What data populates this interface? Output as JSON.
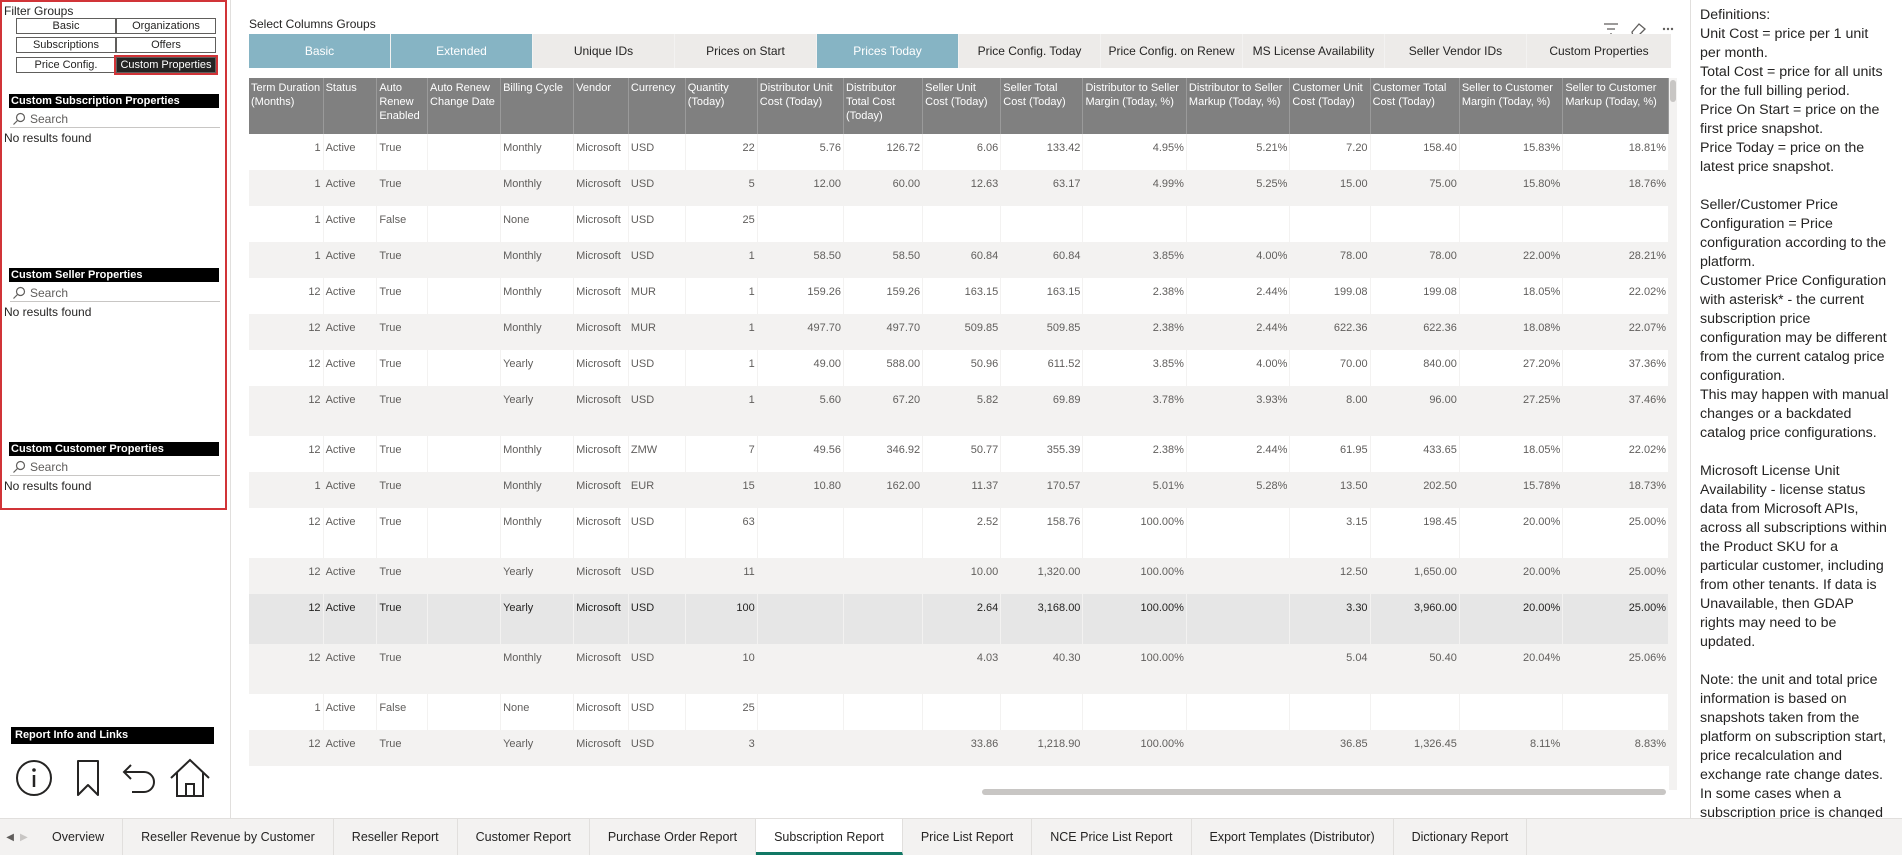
{
  "filter_panel": {
    "title": "Filter Groups",
    "buttons": [
      "Basic",
      "Organizations",
      "Subscriptions",
      "Offers",
      "Price Config.",
      "Custom Properties"
    ],
    "active_button": "Custom Properties",
    "sections": [
      {
        "title": "Custom Subscription Properties",
        "search_placeholder": "Search",
        "empty_text": "No results found"
      },
      {
        "title": "Custom Seller Properties",
        "search_placeholder": "Search",
        "empty_text": "No results found"
      },
      {
        "title": "Custom Customer Properties",
        "search_placeholder": "Search",
        "empty_text": "No results found"
      }
    ]
  },
  "report_info": {
    "title": "Report Info and Links",
    "icons": [
      "info-icon",
      "bookmark-icon",
      "back-arrow-icon",
      "home-icon"
    ]
  },
  "column_groups": {
    "title": "Select Columns Groups",
    "tabs": [
      {
        "label": "Basic",
        "selected": true
      },
      {
        "label": "Extended",
        "selected": true
      },
      {
        "label": "Unique IDs",
        "selected": false
      },
      {
        "label": "Prices on Start",
        "selected": false
      },
      {
        "label": "Prices Today",
        "selected": true
      },
      {
        "label": "Price Config. Today",
        "selected": false
      },
      {
        "label": "Price Config. on Renew",
        "selected": false
      },
      {
        "label": "MS License Availability",
        "selected": false
      },
      {
        "label": "Seller Vendor IDs",
        "selected": false
      },
      {
        "label": "Custom Properties",
        "selected": false
      }
    ],
    "selected_color": "#86b4c4",
    "tools": [
      "filter-icon",
      "eraser-icon",
      "more-options-icon"
    ]
  },
  "table": {
    "headers": [
      "Term Duration (Months)",
      "Status",
      "Auto Renew Enabled",
      "Auto Renew Change Date",
      "Billing Cycle",
      "Vendor",
      "Currency",
      "Quantity (Today)",
      "Distributor Unit Cost (Today)",
      "Distributor Total Cost (Today)",
      "Seller Unit Cost (Today)",
      "Seller Total Cost (Today)",
      "Distributor to Seller Margin (Today, %)",
      "Distributor to Seller Markup (Today, %)",
      "Customer Unit Cost (Today)",
      "Customer Total Cost (Today)",
      "Seller to Customer Margin (Today, %)",
      "Seller to Customer Markup (Today, %)"
    ],
    "rows": [
      [
        "1",
        "Active",
        "True",
        "",
        "Monthly",
        "Microsoft",
        "USD",
        "22",
        "5.76",
        "126.72",
        "6.06",
        "133.42",
        "4.95%",
        "5.21%",
        "7.20",
        "158.40",
        "15.83%",
        "18.81%"
      ],
      [
        "1",
        "Active",
        "True",
        "",
        "Monthly",
        "Microsoft",
        "USD",
        "5",
        "12.00",
        "60.00",
        "12.63",
        "63.17",
        "4.99%",
        "5.25%",
        "15.00",
        "75.00",
        "15.80%",
        "18.76%"
      ],
      [
        "1",
        "Active",
        "False",
        "",
        "None",
        "Microsoft",
        "USD",
        "25",
        "",
        "",
        "",
        "",
        "",
        "",
        "",
        "",
        "",
        ""
      ],
      [
        "1",
        "Active",
        "True",
        "",
        "Monthly",
        "Microsoft",
        "USD",
        "1",
        "58.50",
        "58.50",
        "60.84",
        "60.84",
        "3.85%",
        "4.00%",
        "78.00",
        "78.00",
        "22.00%",
        "28.21%"
      ],
      [
        "12",
        "Active",
        "True",
        "",
        "Monthly",
        "Microsoft",
        "MUR",
        "1",
        "159.26",
        "159.26",
        "163.15",
        "163.15",
        "2.38%",
        "2.44%",
        "199.08",
        "199.08",
        "18.05%",
        "22.02%"
      ],
      [
        "12",
        "Active",
        "True",
        "",
        "Monthly",
        "Microsoft",
        "MUR",
        "1",
        "497.70",
        "497.70",
        "509.85",
        "509.85",
        "2.38%",
        "2.44%",
        "622.36",
        "622.36",
        "18.08%",
        "22.07%"
      ],
      [
        "12",
        "Active",
        "True",
        "",
        "Yearly",
        "Microsoft",
        "USD",
        "1",
        "49.00",
        "588.00",
        "50.96",
        "611.52",
        "3.85%",
        "4.00%",
        "70.00",
        "840.00",
        "27.20%",
        "37.36%"
      ],
      [
        "12",
        "Active",
        "True",
        "",
        "Yearly",
        "Microsoft",
        "USD",
        "1",
        "5.60",
        "67.20",
        "5.82",
        "69.89",
        "3.78%",
        "3.93%",
        "8.00",
        "96.00",
        "27.25%",
        "37.46%"
      ],
      [
        "12",
        "Active",
        "True",
        "",
        "Monthly",
        "Microsoft",
        "ZMW",
        "7",
        "49.56",
        "346.92",
        "50.77",
        "355.39",
        "2.38%",
        "2.44%",
        "61.95",
        "433.65",
        "18.05%",
        "22.02%"
      ],
      [
        "1",
        "Active",
        "True",
        "",
        "Monthly",
        "Microsoft",
        "EUR",
        "15",
        "10.80",
        "162.00",
        "11.37",
        "170.57",
        "5.01%",
        "5.28%",
        "13.50",
        "202.50",
        "15.78%",
        "18.73%"
      ],
      [
        "12",
        "Active",
        "True",
        "",
        "Monthly",
        "Microsoft",
        "USD",
        "63",
        "",
        "",
        "2.52",
        "158.76",
        "100.00%",
        "",
        "3.15",
        "198.45",
        "20.00%",
        "25.00%"
      ],
      [
        "12",
        "Active",
        "True",
        "",
        "Yearly",
        "Microsoft",
        "USD",
        "11",
        "",
        "",
        "10.00",
        "1,320.00",
        "100.00%",
        "",
        "12.50",
        "1,650.00",
        "20.00%",
        "25.00%"
      ],
      [
        "12",
        "Active",
        "True",
        "",
        "Yearly",
        "Microsoft",
        "USD",
        "100",
        "",
        "",
        "2.64",
        "3,168.00",
        "100.00%",
        "",
        "3.30",
        "3,960.00",
        "20.00%",
        "25.00%"
      ],
      [
        "12",
        "Active",
        "True",
        "",
        "Monthly",
        "Microsoft",
        "USD",
        "10",
        "",
        "",
        "4.03",
        "40.30",
        "100.00%",
        "",
        "5.04",
        "50.40",
        "20.04%",
        "25.06%"
      ],
      [
        "1",
        "Active",
        "False",
        "",
        "None",
        "Microsoft",
        "USD",
        "25",
        "",
        "",
        "",
        "",
        "",
        "",
        "",
        "",
        "",
        ""
      ],
      [
        "12",
        "Active",
        "True",
        "",
        "Yearly",
        "Microsoft",
        "USD",
        "3",
        "",
        "",
        "33.86",
        "1,218.90",
        "100.00%",
        "",
        "36.85",
        "1,326.45",
        "8.11%",
        "8.83%"
      ]
    ],
    "highlighted_row": 12,
    "header_bg": "#808080"
  },
  "definitions": {
    "paragraphs": [
      [
        "Definitions:",
        "Unit Cost = price per 1 unit per month.",
        "Total Cost = price for all units for the full billing period.",
        "Price On Start = price on the first price snapshot.",
        "Price Today = price on the latest price snapshot."
      ],
      [
        "Seller/Customer Price Configuration = Price configuration according to the platform.",
        "Customer Price Configuration with asterisk* - the current subscription price configuration may be different from the current catalog price configuration.",
        "This may happen with manual changes or a backdated catalog price configurations."
      ],
      [
        "Microsoft License Unit Availability - license status data from Microsoft APIs, across all subscriptions within the Product SKU for a particular customer, including from other tenants. If data is Unavailable, then GDAP rights may need to be updated."
      ],
      [
        "Note: the unit and total price information is based on snapshots taken from the platform on subscription start, price recalculation and exchange rate change dates. In some cases when a subscription price is changed between these dates, the price"
      ]
    ]
  },
  "bottom_tabs": {
    "nav": [
      "prev-page-icon"
    ],
    "tabs": [
      "Overview",
      "Reseller Revenue by Customer",
      "Reseller Report",
      "Customer Report",
      "Purchase Order Report",
      "Subscription Report",
      "Price List Report",
      "NCE Price List Report",
      "Export Templates (Distributor)",
      "Dictionary Report"
    ],
    "active": "Subscription Report",
    "active_color": "#117865"
  }
}
